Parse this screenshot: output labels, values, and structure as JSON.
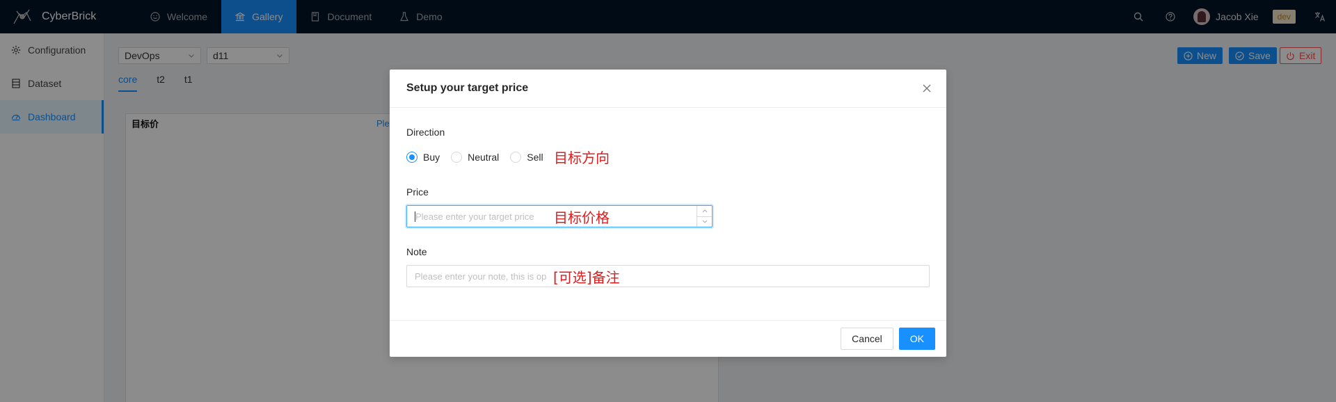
{
  "app": {
    "name": "CyberBrick"
  },
  "nav": [
    {
      "label": "Welcome",
      "icon": "smile-icon"
    },
    {
      "label": "Gallery",
      "icon": "bank-icon",
      "active": true
    },
    {
      "label": "Document",
      "icon": "book-icon"
    },
    {
      "label": "Demo",
      "icon": "experiment-icon"
    }
  ],
  "topbar": {
    "user_name": "Jacob Xie",
    "env": "dev"
  },
  "sidebar": [
    {
      "label": "Configuration",
      "icon": "gear-icon"
    },
    {
      "label": "Dataset",
      "icon": "database-icon"
    },
    {
      "label": "Dashboard",
      "icon": "dashboard-icon",
      "active": true
    }
  ],
  "toolbar": {
    "select1": "DevOps",
    "select2": "d11",
    "new_label": "New",
    "save_label": "Save",
    "exit_label": "Exit"
  },
  "tabs": [
    {
      "label": "core",
      "active": true
    },
    {
      "label": "t2"
    },
    {
      "label": "t1"
    }
  ],
  "card": {
    "title": "目标价",
    "link": "Plea"
  },
  "modal": {
    "title": "Setup your target price",
    "direction_label": "Direction",
    "options": [
      "Buy",
      "Neutral",
      "Sell"
    ],
    "selected": "Buy",
    "direction_annotation": "目标方向",
    "price_label": "Price",
    "price_placeholder": "Please enter your target price",
    "price_annotation": "目标价格",
    "note_label": "Note",
    "note_placeholder": "Please enter your note, this is op",
    "note_annotation": "[可选]备注",
    "cancel_label": "Cancel",
    "ok_label": "OK"
  },
  "colors": {
    "header_bg": "#001529",
    "primary": "#1890ff",
    "danger": "#ff4d4f",
    "annotation": "#e01b1b"
  }
}
